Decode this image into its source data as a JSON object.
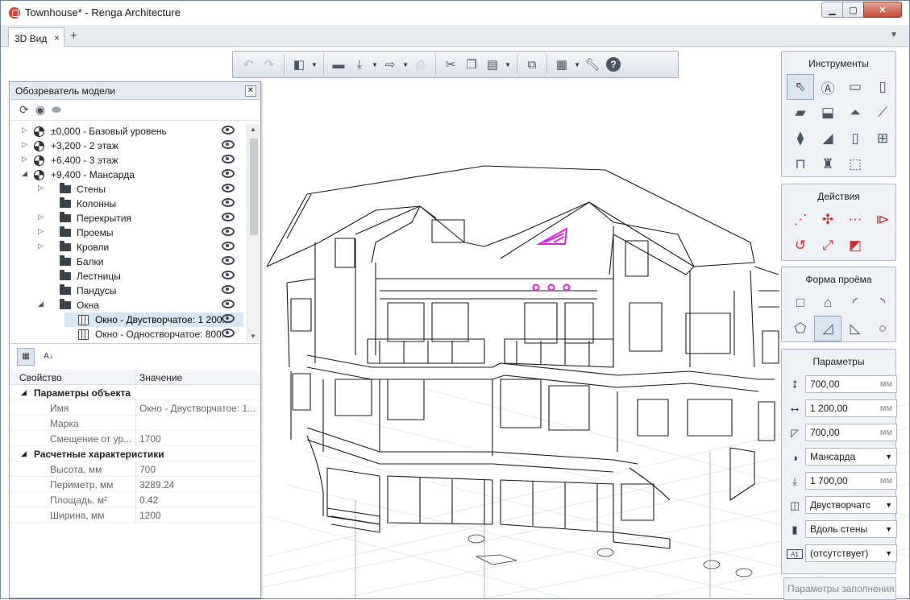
{
  "window": {
    "title": "Townhouse* - Renga Architecture"
  },
  "tabs": [
    {
      "label": "3D Вид",
      "close": "×"
    }
  ],
  "tabbar": {
    "add": "+",
    "menu": "▼"
  },
  "model_browser": {
    "title": "Обозреватель модели",
    "tree": [
      {
        "label": "±0,000 - Базовый уровень",
        "depth": 0,
        "icon": "level-icon",
        "expand": "right"
      },
      {
        "label": "+3,200 - 2 этаж",
        "depth": 0,
        "icon": "level-icon",
        "expand": "right"
      },
      {
        "label": "+6,400 - 3 этаж",
        "depth": 0,
        "icon": "level-icon",
        "expand": "right"
      },
      {
        "label": "+9,400 - Мансарда",
        "depth": 0,
        "icon": "level-icon",
        "expand": "down"
      },
      {
        "label": "Стены",
        "depth": 1,
        "icon": "folder-icon",
        "expand": "right"
      },
      {
        "label": "Колонны",
        "depth": 1,
        "icon": "folder-icon",
        "expand": "none"
      },
      {
        "label": "Перекрытия",
        "depth": 1,
        "icon": "folder-icon",
        "expand": "right"
      },
      {
        "label": "Проемы",
        "depth": 1,
        "icon": "folder-icon",
        "expand": "right"
      },
      {
        "label": "Кровли",
        "depth": 1,
        "icon": "folder-icon",
        "expand": "right"
      },
      {
        "label": "Балки",
        "depth": 1,
        "icon": "folder-icon",
        "expand": "none"
      },
      {
        "label": "Лестницы",
        "depth": 1,
        "icon": "folder-icon",
        "expand": "none"
      },
      {
        "label": "Пандусы",
        "depth": 1,
        "icon": "folder-icon",
        "expand": "none"
      },
      {
        "label": "Окна",
        "depth": 1,
        "icon": "folder-icon",
        "expand": "down"
      },
      {
        "label": "Окно - Двустворчатое: 1 200...",
        "depth": 2,
        "icon": "window-icon",
        "expand": "none",
        "selected": true
      },
      {
        "label": "Окно - Одностворчатое: 800...",
        "depth": 2,
        "icon": "window-icon",
        "expand": "none"
      }
    ],
    "props_header": {
      "key": "Свойство",
      "value": "Значение"
    },
    "props": [
      {
        "type": "group",
        "key": "Параметры объекта"
      },
      {
        "type": "item",
        "key": "Имя",
        "value": "Окно - Двустворчатое: 1..."
      },
      {
        "type": "item",
        "key": "Марка",
        "value": ""
      },
      {
        "type": "item",
        "key": "Смещение от ур...",
        "value": "1700"
      },
      {
        "type": "group",
        "key": "Расчетные характеристики"
      },
      {
        "type": "item",
        "key": "Высота, мм",
        "value": "700"
      },
      {
        "type": "item",
        "key": "Периметр, мм",
        "value": "3289.24"
      },
      {
        "type": "item",
        "key": "Площадь, м²",
        "value": "0.42"
      },
      {
        "type": "item",
        "key": "Ширина, мм",
        "value": "1200"
      }
    ]
  },
  "panels": {
    "tools": {
      "title": "Инструменты"
    },
    "actions": {
      "title": "Действия"
    },
    "opening_shape": {
      "title": "Форма проёма"
    },
    "params": {
      "title": "Параметры",
      "fields": [
        {
          "name": "height",
          "value": "700,00",
          "unit": "мм",
          "icon": "height-icon",
          "kind": "number"
        },
        {
          "name": "width",
          "value": "1 200,00",
          "unit": "мм",
          "icon": "width-icon",
          "kind": "number"
        },
        {
          "name": "depth",
          "value": "700,00",
          "unit": "мм",
          "icon": "depth-icon",
          "kind": "number"
        },
        {
          "name": "level",
          "value": "Мансарда",
          "icon": "level-select-icon",
          "kind": "select"
        },
        {
          "name": "offset",
          "value": "1 700,00",
          "unit": "мм",
          "icon": "offset-icon",
          "kind": "number"
        },
        {
          "name": "window-type",
          "value": "Двустворчатс",
          "icon": "window-type-icon",
          "kind": "select"
        },
        {
          "name": "alignment",
          "value": "Вдоль стены",
          "icon": "alignment-icon",
          "kind": "select"
        },
        {
          "name": "mark",
          "value": "(отсутствует)",
          "icon": "mark-icon",
          "kind": "select"
        }
      ]
    },
    "next_panel_label": "Параметры заполнения"
  },
  "scene": {
    "building": "Townhouse 3D view",
    "highlight_color": "#e020e0"
  }
}
